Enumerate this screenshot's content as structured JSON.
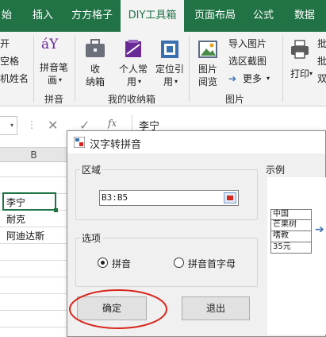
{
  "ribbon_tabs": [
    "始",
    "插入",
    "方方格子",
    "DIY工具箱",
    "页面布局",
    "公式",
    "数据"
  ],
  "ribbon": {
    "partial_left": [
      "开",
      "空格",
      "机姓名"
    ],
    "pinyin_glyph": "áY",
    "pinyin_button": [
      "拼音笔",
      "画"
    ],
    "pinyin_group": "拼音",
    "store_button": [
      "收",
      "纳箱"
    ],
    "personal_button": [
      "个人常",
      "用"
    ],
    "locate_button": [
      "定位引",
      "用"
    ],
    "collection_group": "我的收纳箱",
    "picture_view": [
      "图片",
      "阅览"
    ],
    "import_picture": "导入图片",
    "region_screenshot": "选区截图",
    "more": "更多",
    "picture_group": "图片",
    "print": "打印",
    "partial_right": [
      "批",
      "批",
      "双"
    ]
  },
  "formula_bar": {
    "value": "李宁",
    "cancel_icon": "close-icon",
    "enter_icon": "check-icon",
    "fx_icon": "fx"
  },
  "sheet": {
    "column_header": "B",
    "cells": [
      "李宁",
      "耐克",
      "阿迪达斯"
    ]
  },
  "dialog": {
    "title": "汉字转拼音",
    "region_label": "区域",
    "range_value": "B3:B5",
    "options_label": "选项",
    "option_pinyin": "拼音",
    "option_initials": "拼音首字母",
    "selected_option": "拼音",
    "ok_button": "确定",
    "exit_button": "退出",
    "example_label": "示例",
    "example_items": [
      "中国",
      "芒果树",
      "嗜教",
      "35元"
    ]
  },
  "colors": {
    "excel_green": "#217346",
    "annotation_red": "#d9261c"
  }
}
